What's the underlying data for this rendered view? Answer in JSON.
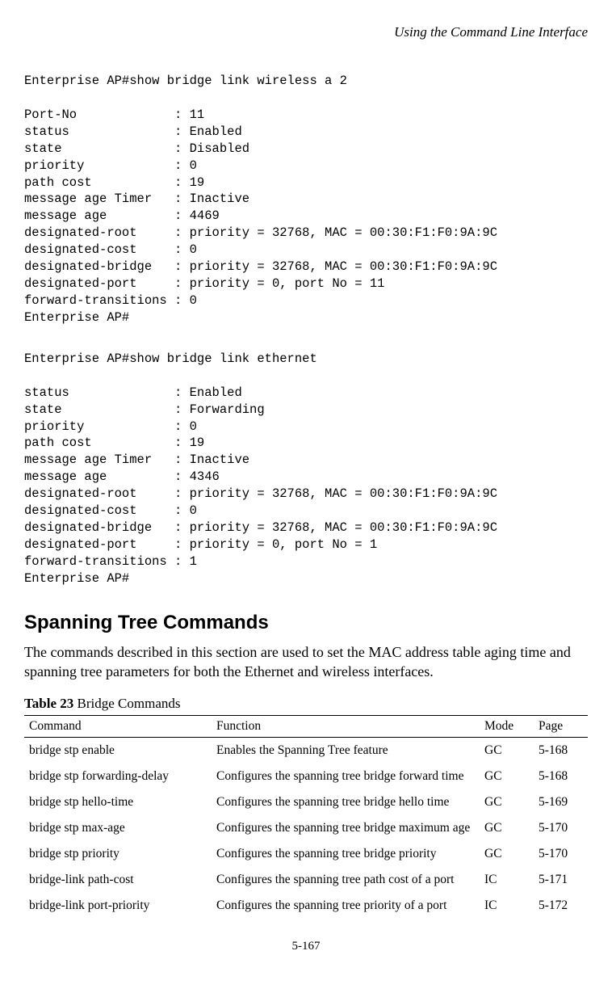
{
  "running_header": "Using the Command Line Interface",
  "terminal1": {
    "cmdline": "Enterprise AP#show bridge link wireless a 2",
    "rows": [
      [
        "Port-No",
        "11"
      ],
      [
        "status",
        "Enabled"
      ],
      [
        "state",
        "Disabled"
      ],
      [
        "priority",
        "0"
      ],
      [
        "path cost",
        "19"
      ],
      [
        "message age Timer",
        "Inactive"
      ],
      [
        "message age",
        "4469"
      ],
      [
        "designated-root",
        "priority = 32768, MAC = 00:30:F1:F0:9A:9C"
      ],
      [
        "designated-cost",
        "0"
      ],
      [
        "designated-bridge",
        "priority = 32768, MAC = 00:30:F1:F0:9A:9C"
      ],
      [
        "designated-port",
        "priority = 0, port No = 11"
      ],
      [
        "forward-transitions",
        "0"
      ]
    ],
    "prompt": "Enterprise AP#"
  },
  "terminal2": {
    "cmdline": "Enterprise AP#show bridge link ethernet",
    "rows": [
      [
        "status",
        "Enabled"
      ],
      [
        "state",
        "Forwarding"
      ],
      [
        "priority",
        "0"
      ],
      [
        "path cost",
        "19"
      ],
      [
        "message age Timer",
        "Inactive"
      ],
      [
        "message age",
        "4346"
      ],
      [
        "designated-root",
        "priority = 32768, MAC = 00:30:F1:F0:9A:9C"
      ],
      [
        "designated-cost",
        "0"
      ],
      [
        "designated-bridge",
        "priority = 32768, MAC = 00:30:F1:F0:9A:9C"
      ],
      [
        "designated-port",
        "priority = 0, port No = 1"
      ],
      [
        "forward-transitions",
        "1"
      ]
    ],
    "prompt": "Enterprise AP#"
  },
  "section": {
    "heading": "Spanning Tree Commands",
    "description": "The commands described in this section are used to set the MAC address table aging time and spanning tree parameters for both the Ethernet and wireless interfaces."
  },
  "table": {
    "caption_lead": "Table 23",
    "caption_rest": "   Bridge Commands",
    "headers": {
      "command": "Command",
      "function": "Function",
      "mode": "Mode",
      "page": "Page"
    },
    "rows": [
      {
        "command": "bridge stp enable",
        "function": "Enables the Spanning Tree feature",
        "mode": "GC",
        "page": "5-168"
      },
      {
        "command": "bridge stp forwarding-delay",
        "function": "Configures the spanning tree bridge forward time",
        "mode": "GC",
        "page": "5-168"
      },
      {
        "command": "bridge stp hello-time",
        "function": "Configures the spanning tree bridge hello time",
        "mode": "GC",
        "page": "5-169"
      },
      {
        "command": "bridge stp max-age",
        "function": "Configures the spanning tree bridge maximum age",
        "mode": "GC",
        "page": "5-170"
      },
      {
        "command": "bridge stp priority",
        "function": "Configures the spanning tree bridge priority",
        "mode": "GC",
        "page": "5-170"
      },
      {
        "command": "bridge-link path-cost",
        "function": "Configures the spanning tree path cost of a port",
        "mode": "IC",
        "page": "5-171"
      },
      {
        "command": "bridge-link port-priority",
        "function": "Configures the spanning tree priority of a port",
        "mode": "IC",
        "page": "5-172"
      }
    ]
  },
  "page_number": "5-167"
}
